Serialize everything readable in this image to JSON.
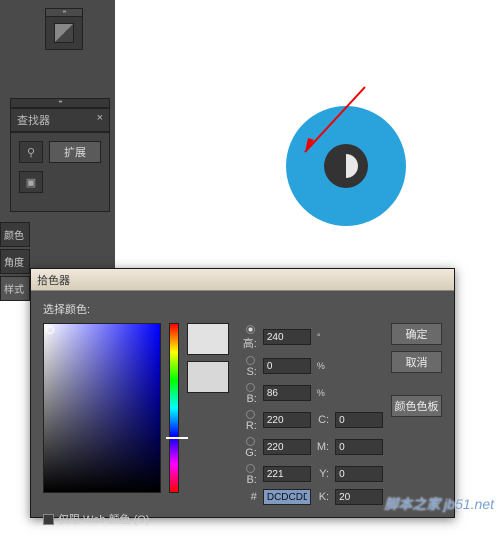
{
  "panels": {
    "finder_tab": "查找器",
    "mask_btn": "扩展"
  },
  "side_tabs": [
    "颜色",
    "角度",
    "样式"
  ],
  "dialog": {
    "title": "拾色器",
    "select_label": "选择颜色:",
    "buttons": {
      "ok": "确定",
      "cancel": "取消",
      "swatches": "颜色色板"
    },
    "fields": {
      "H": {
        "label": "高:",
        "value": "240",
        "unit": "°"
      },
      "S": {
        "label": "S:",
        "value": "0",
        "unit": "%"
      },
      "B": {
        "label": "B:",
        "value": "86",
        "unit": "%"
      },
      "R": {
        "label": "R:",
        "value": "220"
      },
      "G": {
        "label": "G:",
        "value": "220"
      },
      "Bl": {
        "label": "B:",
        "value": "221"
      },
      "C": {
        "label": "C:",
        "value": "0",
        "unit": "%"
      },
      "M": {
        "label": "M:",
        "value": "0",
        "unit": "%"
      },
      "Y": {
        "label": "Y:",
        "value": "0",
        "unit": "%"
      },
      "K": {
        "label": "K:",
        "value": "20",
        "unit": "%"
      },
      "hex": {
        "label": "#",
        "value": "DCDCDD"
      }
    },
    "web_only": "仅限 Web 颜色 (O)"
  },
  "watermark": "脚本之家 jb51.net"
}
